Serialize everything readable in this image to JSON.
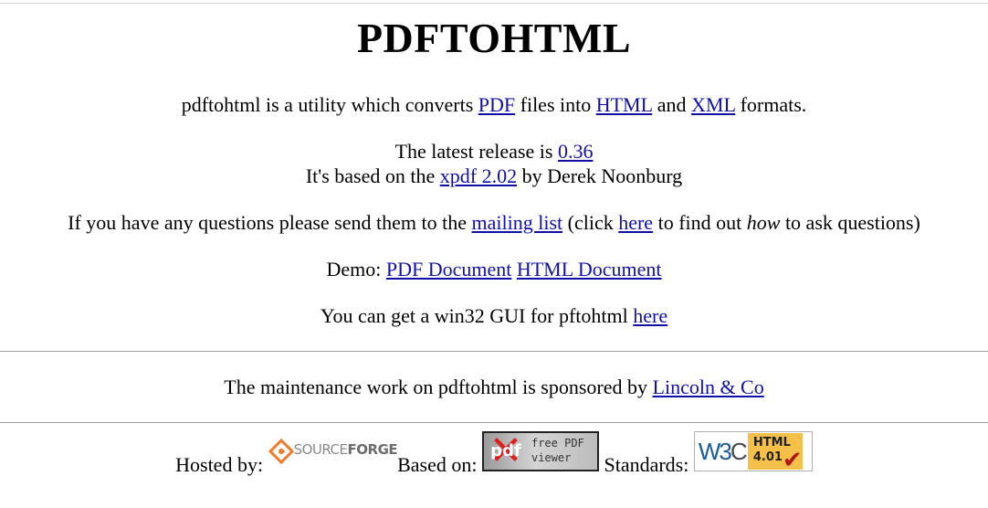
{
  "page": {
    "title": "PDFTOHTML"
  },
  "intro": {
    "prefix": "pdftohtml is a utility which converts ",
    "link_pdf": "PDF",
    "mid1": " files into ",
    "link_html": "HTML",
    "mid2": " and ",
    "link_xml": "XML",
    "suffix": " formats."
  },
  "release": {
    "prefix": "The latest release is ",
    "version_link": "0.36",
    "based_prefix": "It's based on the ",
    "xpdf_link": "xpdf 2.02",
    "based_suffix": " by Derek Noonburg"
  },
  "questions": {
    "prefix": "If you have any questions please send them to the ",
    "mailing_list_link": "mailing list",
    "mid": " (click ",
    "here_link": "here",
    "mid2": " to find out ",
    "how": "how",
    "suffix": " to ask questions)"
  },
  "demo": {
    "label": "Demo: ",
    "pdf_link": "PDF Document",
    "html_link": "HTML Document"
  },
  "gui": {
    "text": "You can get a win32 GUI for pftohtml ",
    "here_link": "here"
  },
  "sponsor": {
    "text": "The maintenance work on pdftohtml is sponsored by ",
    "link": "Lincoln & Co"
  },
  "footer": {
    "hosted_label": "Hosted by:",
    "sourceforge_light": "SOURCE",
    "sourceforge_bold": "FORGE",
    "based_label": "Based on:",
    "pdf_badge_logo": "pdf",
    "pdf_badge_line1": "free PDF",
    "pdf_badge_line2": "viewer",
    "standards_label": "Standards:",
    "w3c_logo": "W3",
    "w3c_logo_c": "C",
    "w3c_html": "HTML",
    "w3c_version": "4.01",
    "w3c_check": "✔"
  },
  "colors": {
    "link": "#1010a8",
    "rule": "#a0a0a0",
    "sourceforge_orange": "#f07c2e",
    "pdf_red": "#e21b1b",
    "w3c_yellow": "#f5c04a",
    "w3c_blue": "#1a5a9a",
    "check_red": "#b01818"
  }
}
